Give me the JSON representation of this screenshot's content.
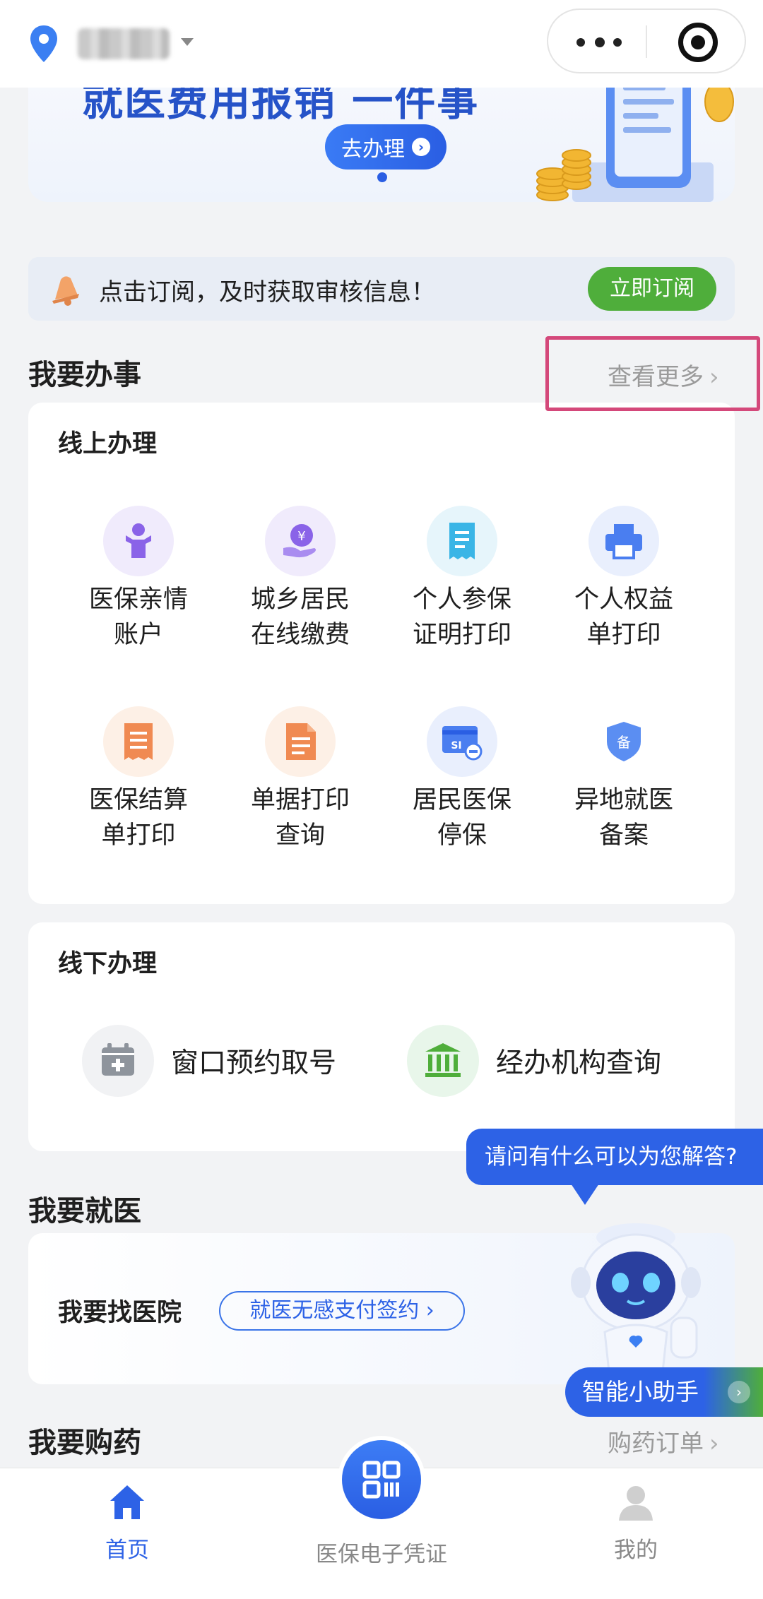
{
  "topbar": {
    "location_text": ""
  },
  "banner": {
    "title": "就医费用报销 一件事",
    "button_label": "去办理"
  },
  "subscribe": {
    "text": "点击订阅，及时获取审核信息！",
    "button_label": "立即订阅"
  },
  "tasks": {
    "title": "我要办事",
    "more_label": "查看更多"
  },
  "online": {
    "title": "线上办理",
    "items": [
      {
        "line1": "医保亲情",
        "line2": "账户",
        "icon": "family-account-icon",
        "color": "#8a63e8"
      },
      {
        "line1": "城乡居民",
        "line2": "在线缴费",
        "icon": "yuan-payment-icon",
        "color": "#8a63e8"
      },
      {
        "line1": "个人参保",
        "line2": "证明打印",
        "icon": "document-icon",
        "color": "#3ab5e6"
      },
      {
        "line1": "个人权益",
        "line2": "单打印",
        "icon": "printer-icon",
        "color": "#4a7ef0"
      },
      {
        "line1": "医保结算",
        "line2": "单打印",
        "icon": "receipt-icon",
        "color": "#f08a52"
      },
      {
        "line1": "单据打印",
        "line2": "查询",
        "icon": "file-icon",
        "color": "#f08a52"
      },
      {
        "line1": "居民医保",
        "line2": "停保",
        "icon": "si-card-icon",
        "color": "#4a7ef0"
      },
      {
        "line1": "异地就医",
        "line2": "备案",
        "icon": "shield-record-icon",
        "color": "#4a7ef0"
      }
    ]
  },
  "offline": {
    "title": "线下办理",
    "items": [
      {
        "label": "窗口预约取号",
        "icon": "calendar-add-icon"
      },
      {
        "label": "经办机构查询",
        "icon": "institution-icon"
      }
    ]
  },
  "chat_bubble": "请问有什么可以为您解答?",
  "medical": {
    "title": "我要就医",
    "card_title": "我要找医院",
    "pill_label": "就医无感支付签约"
  },
  "assistant_label": "智能小助手",
  "drugs": {
    "title": "我要购药",
    "more_label": "购药订单"
  },
  "bottom_nav": {
    "home": "首页",
    "voucher": "医保电子凭证",
    "mine": "我的"
  },
  "colors": {
    "primary": "#2d62e6",
    "green": "#4fae3b",
    "highlight": "#d4487a"
  }
}
